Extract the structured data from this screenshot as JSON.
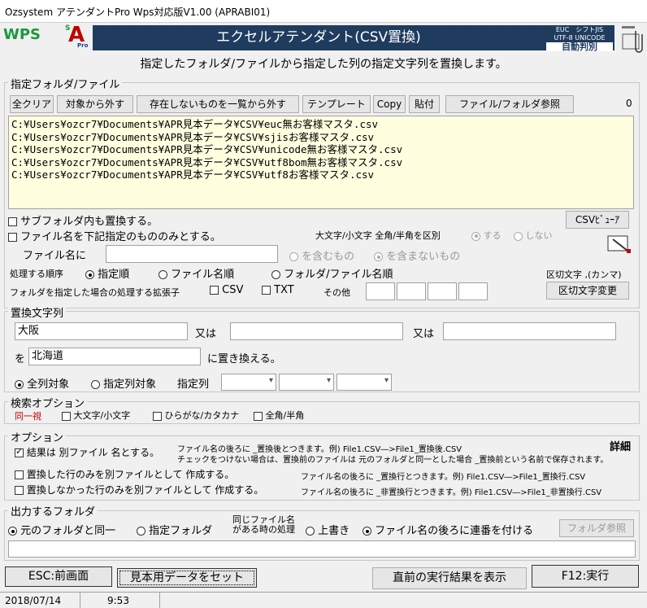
{
  "window_title": "Ozsystem アテンダントPro Wps対応版V1.00 (APRABI01)",
  "logo_wps": "WPS",
  "logo_sap": {
    "s": "S",
    "a": "A",
    "pro": "Pro"
  },
  "banner_title": "エクセルアテンダント(CSV置換)",
  "encoding_badge": {
    "line1": "EUC　シフトJIS",
    "line2": "UTF-8 UNICODE",
    "line3": "自動判別"
  },
  "description": "指定したフォルダ/ファイルから指定した列の指定文字列を置換します。",
  "folder_section": {
    "label": "指定フォルダ/ファイル",
    "buttons": {
      "clear_all": "全クリア",
      "remove": "対象から外す",
      "remove_missing": "存在しないものを一覧から外す",
      "template": "テンプレート",
      "copy": "Copy",
      "paste": "貼付",
      "browse": "ファイル/フォルダ参照"
    },
    "count": "0",
    "files": [
      "C:¥Users¥ozcr7¥Documents¥APR見本データ¥CSV¥euc無お客様マスタ.csv",
      "C:¥Users¥ozcr7¥Documents¥APR見本データ¥CSV¥sjisお客様マスタ.csv",
      "C:¥Users¥ozcr7¥Documents¥APR見本データ¥CSV¥unicode無お客様マスタ.csv",
      "C:¥Users¥ozcr7¥Documents¥APR見本データ¥CSV¥utf8bom無お客様マスタ.csv",
      "C:¥Users¥ozcr7¥Documents¥APR見本データ¥CSV¥utf8お客様マスタ.csv"
    ],
    "subfolder": "サブフォルダ内も置換する。",
    "name_filter": "ファイル名を下記指定のもののみとする。",
    "csv_viewer": "CSVﾋﾞｭｰｱ",
    "case_label": "大文字/小文字 全角/半角を区別",
    "case_yes": "する",
    "case_no": "しない",
    "filename_label": "ファイル名に",
    "filename_value": "",
    "contains": "を含むもの",
    "not_contains": "を含まないもの",
    "order_label": "処理する順序",
    "order_specified": "指定順",
    "order_filename": "ファイル名順",
    "order_folder": "フォルダ/ファイル名順",
    "delimiter_label": "区切文字 ,(カンマ)",
    "ext_label": "フォルダを指定した場合の処理する拡張子",
    "ext_csv": "CSV",
    "ext_txt": "TXT",
    "ext_other": "その他",
    "delimiter_change": "区切文字変更"
  },
  "replace_section": {
    "label": "置換文字列",
    "search1": "大阪",
    "or1": "又は",
    "search2": "",
    "or2": "又は",
    "search3": "",
    "wo": "を",
    "replace_with": "北海道",
    "replace_suffix": "に置き換える。",
    "all_columns": "全列対象",
    "specified_columns": "指定列対象",
    "column_label": "指定列"
  },
  "search_options": {
    "label": "検索オプション",
    "same": "同一視",
    "case": "大文字/小文字",
    "kana": "ひらがな/カタカナ",
    "width": "全角/半角"
  },
  "options": {
    "label": "オプション",
    "result_separate": "結果は 別ファイル 名とする。",
    "note1": "ファイル名の後ろに _置換後とつきます。例) File1.CSV―>File1_置換後.CSV",
    "note2": "チェックをつけない場合は、置換前のファイルは 元のフォルダと同一とした場合 _置換前という名前で保存されます。",
    "detail": "詳細",
    "only_replaced": "置換した行のみを別ファイルとして 作成する。",
    "note3": "ファイル名の後ろに _置換行とつきます。例) File1.CSV―>File1_置換行.CSV",
    "only_not_replaced": "置換しなかった行のみを別ファイルとして 作成する。",
    "note4": "ファイル名の後ろに _非置換行とつきます。例) File1.CSV―>File1_非置換行.CSV"
  },
  "output_section": {
    "label": "出力するフォルダ",
    "same_folder": "元のフォルダと同一",
    "specified_folder": "指定フォルダ",
    "same_name_line1": "同じファイル名",
    "same_name_line2": "がある時の処理",
    "overwrite": "上書き",
    "append_number": "ファイル名の後ろに連番を付ける",
    "folder_browse": "フォルダ参照",
    "path": ""
  },
  "footer_buttons": {
    "back": "ESC:前画面",
    "sample": "見本用データをセット",
    "show_last": "直前の実行結果を表示",
    "run": "F12:実行"
  },
  "status": {
    "date": "2018/07/14",
    "time": "9:53"
  },
  "colors": {
    "banner": "#1f3c5f",
    "list_bg": "#ffffe0",
    "wps_green": "#1a9a3a",
    "red_label": "#c00000"
  }
}
